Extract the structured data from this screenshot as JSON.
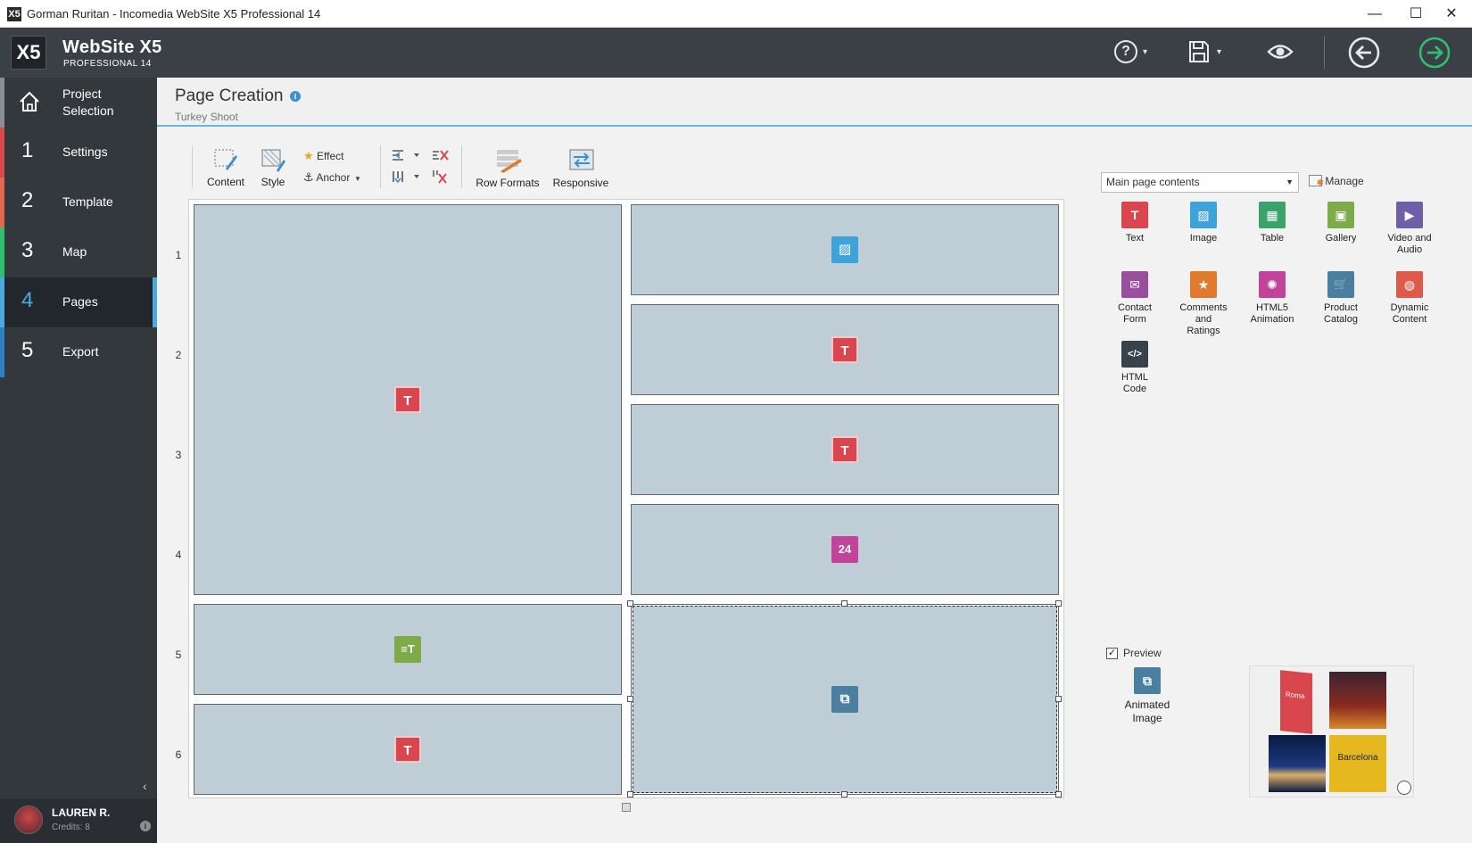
{
  "window": {
    "title": "Gorman Ruritan - Incomedia WebSite X5 Professional 14",
    "minimize": "—",
    "maximize": "☐",
    "close": "✕"
  },
  "header": {
    "logo_mark": "X5",
    "product": "WebSite X5",
    "edition": "PROFESSIONAL 14",
    "help_icon": "?",
    "save_icon": "save",
    "preview_icon": "eye",
    "back_icon": "arrow-left",
    "forward_icon": "arrow-right",
    "accent": "#2fbf71"
  },
  "sidebar": {
    "items": [
      {
        "num": "",
        "label_line1": "Project",
        "label_line2": "Selection",
        "color": "#8a8f94"
      },
      {
        "num": "1",
        "label": "Settings",
        "color": "#d9464e"
      },
      {
        "num": "2",
        "label": "Template",
        "color": "#e2674e"
      },
      {
        "num": "3",
        "label": "Map",
        "color": "#2fbf71"
      },
      {
        "num": "4",
        "label": "Pages",
        "color": "#4ba8e0"
      },
      {
        "num": "5",
        "label": "Export",
        "color": "#2f7fc4"
      }
    ],
    "collapse": "‹",
    "user": {
      "name": "LAUREN R.",
      "credits": "Credits: 8",
      "info": "i"
    }
  },
  "page": {
    "title": "Page Creation",
    "subtitle": "Turkey Shoot",
    "info": "i"
  },
  "toolbar": {
    "content": "Content",
    "style": "Style",
    "effect": "Effect",
    "anchor": "Anchor",
    "row_formats": "Row Formats",
    "responsive": "Responsive"
  },
  "grid": {
    "rows": [
      "1",
      "2",
      "3",
      "4",
      "5",
      "6"
    ],
    "icons": {
      "text": "T",
      "image": "▨",
      "dynamic": "24",
      "title": "≡T",
      "anim": "⧉"
    }
  },
  "panel": {
    "dropdown_value": "Main page contents",
    "manage": "Manage",
    "components": [
      {
        "line1": "Text",
        "line2": "",
        "line3": "",
        "color": "#d9464e",
        "glyph": "T"
      },
      {
        "line1": "Image",
        "line2": "",
        "line3": "",
        "color": "#3ea3d8",
        "glyph": "▨"
      },
      {
        "line1": "Table",
        "line2": "",
        "line3": "",
        "color": "#3aa36c",
        "glyph": "▦"
      },
      {
        "line1": "Gallery",
        "line2": "",
        "line3": "",
        "color": "#7dab4a",
        "glyph": "▣"
      },
      {
        "line1": "Video and",
        "line2": "Audio",
        "line3": "",
        "color": "#6e5fa8",
        "glyph": "▶"
      },
      {
        "line1": "Contact",
        "line2": "Form",
        "line3": "",
        "color": "#9a4f9e",
        "glyph": "✉"
      },
      {
        "line1": "Comments",
        "line2": "and",
        "line3": "Ratings",
        "color": "#e07a2f",
        "glyph": "★"
      },
      {
        "line1": "HTML5",
        "line2": "Animation",
        "line3": "",
        "color": "#c2449a",
        "glyph": "✺"
      },
      {
        "line1": "Product",
        "line2": "Catalog",
        "line3": "",
        "color": "#4a7fa0",
        "glyph": "🛒"
      },
      {
        "line1": "Dynamic",
        "line2": "Content",
        "line3": "",
        "color": "#e05a4a",
        "glyph": "◍"
      },
      {
        "line1": "HTML",
        "line2": "Code",
        "line3": "",
        "color": "#37424c",
        "glyph": "</>"
      }
    ],
    "preview_label": "Preview",
    "preview_checked": "✓",
    "animated_line1": "Animated",
    "animated_line2": "Image",
    "thumb_label": "Barcelona",
    "thumb_tag": "Roma"
  }
}
